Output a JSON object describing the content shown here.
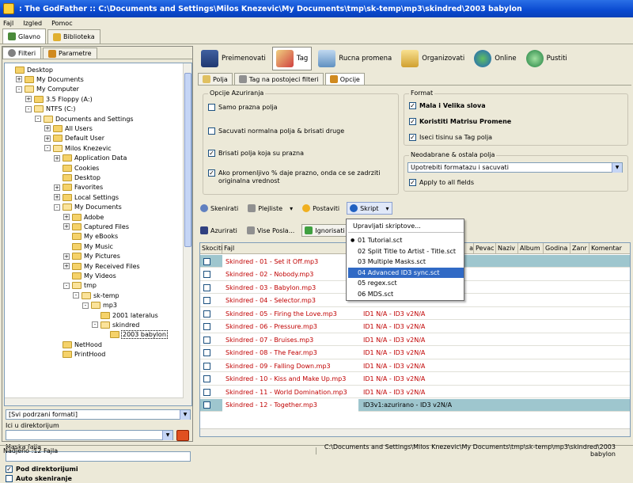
{
  "window": {
    "title": ": The GodFather ::   C:\\Documents and Settings\\Milos Knezevic\\My Documents\\tmp\\sk-temp\\mp3\\skindred\\2003 babylon"
  },
  "menu": [
    "Fajl",
    "Izgled",
    "Pomoc"
  ],
  "top_tabs": [
    {
      "label": "Glavno"
    },
    {
      "label": "Biblioteka"
    }
  ],
  "left_tabs": [
    {
      "label": "Filteri"
    },
    {
      "label": "Parametre"
    }
  ],
  "tree": [
    {
      "label": "Desktop",
      "indent": 0,
      "exp": ""
    },
    {
      "label": "My Documents",
      "indent": 1,
      "exp": "+"
    },
    {
      "label": "My Computer",
      "indent": 1,
      "exp": "-"
    },
    {
      "label": "3.5 Floppy (A:)",
      "indent": 2,
      "exp": "+"
    },
    {
      "label": "NTFS (C:)",
      "indent": 2,
      "exp": "-"
    },
    {
      "label": "Documents and Settings",
      "indent": 3,
      "exp": "-"
    },
    {
      "label": "All Users",
      "indent": 4,
      "exp": "+"
    },
    {
      "label": "Default User",
      "indent": 4,
      "exp": "+"
    },
    {
      "label": "Milos Knezevic",
      "indent": 4,
      "exp": "-"
    },
    {
      "label": "Application Data",
      "indent": 5,
      "exp": "+"
    },
    {
      "label": "Cookies",
      "indent": 5,
      "exp": ""
    },
    {
      "label": "Desktop",
      "indent": 5,
      "exp": ""
    },
    {
      "label": "Favorites",
      "indent": 5,
      "exp": "+"
    },
    {
      "label": "Local Settings",
      "indent": 5,
      "exp": "+"
    },
    {
      "label": "My Documents",
      "indent": 5,
      "exp": "-"
    },
    {
      "label": "Adobe",
      "indent": 6,
      "exp": "+"
    },
    {
      "label": "Captured Files",
      "indent": 6,
      "exp": "+"
    },
    {
      "label": "My eBooks",
      "indent": 6,
      "exp": ""
    },
    {
      "label": "My Music",
      "indent": 6,
      "exp": ""
    },
    {
      "label": "My Pictures",
      "indent": 6,
      "exp": "+"
    },
    {
      "label": "My Received Files",
      "indent": 6,
      "exp": "+"
    },
    {
      "label": "My Videos",
      "indent": 6,
      "exp": ""
    },
    {
      "label": "tmp",
      "indent": 6,
      "exp": "-"
    },
    {
      "label": "sk-temp",
      "indent": 7,
      "exp": "-"
    },
    {
      "label": "mp3",
      "indent": 8,
      "exp": "-"
    },
    {
      "label": "2001 lateralus",
      "indent": 9,
      "exp": ""
    },
    {
      "label": "skindred",
      "indent": 9,
      "exp": "-"
    },
    {
      "label": "2003 babylon",
      "indent": 10,
      "exp": ""
    },
    {
      "label": "NetHood",
      "indent": 5,
      "exp": ""
    },
    {
      "label": "PrintHood",
      "indent": 5,
      "exp": ""
    }
  ],
  "left_bottom": {
    "format_select": "[Svi podrzani formati]",
    "dir_label": "Ici u direktorijum",
    "dir_value": "",
    "mask_label": "Maska fajla",
    "mask_value": "",
    "subdirs_label": "Pod direktorijumi",
    "autoscan_label": "Auto skeniranje"
  },
  "big_toolbar": [
    {
      "label": "Preimenovati"
    },
    {
      "label": "Tag"
    },
    {
      "label": "Rucna promena"
    },
    {
      "label": "Organizovati"
    },
    {
      "label": "Online"
    },
    {
      "label": "Pustiti"
    }
  ],
  "sub_tabs": [
    {
      "label": "Polja"
    },
    {
      "label": "Tag na postojeci filteri"
    },
    {
      "label": "Opcije"
    }
  ],
  "options_group": {
    "title": "Opcije Azuriranja",
    "items": [
      {
        "label": "Samo prazna polja",
        "checked": false
      },
      {
        "label": "Sacuvati normalna polja & brisati druge",
        "checked": false
      },
      {
        "label": "Brisati polja koja su prazna",
        "checked": true
      },
      {
        "label": "Ako promenljivo % daje prazno, onda ce se zadrziti originalna vrednost",
        "checked": true
      }
    ]
  },
  "format_group": {
    "title": "Format",
    "items": [
      {
        "label": "Mala i Velika slova",
        "checked": true
      },
      {
        "label": "Koristiti Matrisu Promene",
        "checked": true
      },
      {
        "label": "Iseci tisinu sa Tag polja",
        "checked": true
      }
    ]
  },
  "unselected_group": {
    "title": "Neodabrane & ostala polja",
    "select_value": "Upotrebiti formatazu i sacuvati",
    "apply_all": "Apply to all fields"
  },
  "toolbar2": [
    {
      "label": "Skenirati"
    },
    {
      "label": "Plejliste"
    },
    {
      "label": "Postaviti"
    },
    {
      "label": "Skript"
    }
  ],
  "toolbar3": [
    {
      "label": "Azurirati"
    },
    {
      "label": "Vise Posla..."
    },
    {
      "label": "Ignorisati"
    }
  ],
  "popup": {
    "header": "Upravljati skriptove...",
    "items": [
      "01 Tutorial.sct",
      "02 Split Title to Artist - Title.sct",
      "03 Multiple Masks.sct",
      "04 Advanced ID3 sync.sct",
      "05 regex.sct",
      "06 MDS.sct"
    ],
    "selected_index": 3,
    "bullet_index": 0
  },
  "table": {
    "columns": [
      "Skociti",
      "Fajl",
      "a",
      "Pevac",
      "Naziv",
      "Album",
      "Godina",
      "Zanr",
      "Komentar"
    ],
    "rows": [
      {
        "file": "Skindred - 01 - Set it Off.mp3",
        "tag": "",
        "hl": true
      },
      {
        "file": "Skindred - 02 - Nobody.mp3",
        "tag": "",
        "hl": false
      },
      {
        "file": "Skindred - 03 - Babylon.mp3",
        "tag": "",
        "hl": false
      },
      {
        "file": "Skindred - 04 - Selector.mp3",
        "tag": "",
        "hl": false
      },
      {
        "file": "Skindred - 05 - Firing the Love.mp3",
        "tag": "ID1 N/A - ID3 v2N/A",
        "hl": false
      },
      {
        "file": "Skindred - 06 - Pressure.mp3",
        "tag": "ID1 N/A - ID3 v2N/A",
        "hl": false
      },
      {
        "file": "Skindred - 07 - Bruises.mp3",
        "tag": "ID1 N/A - ID3 v2N/A",
        "hl": false
      },
      {
        "file": "Skindred - 08 - The Fear.mp3",
        "tag": "ID1 N/A - ID3 v2N/A",
        "hl": false
      },
      {
        "file": "Skindred - 09 - Falling Down.mp3",
        "tag": "ID1 N/A - ID3 v2N/A",
        "hl": false
      },
      {
        "file": "Skindred - 10 - Kiss and Make Up.mp3",
        "tag": "ID1 N/A - ID3 v2N/A",
        "hl": false
      },
      {
        "file": "Skindred - 11 - World Domination.mp3",
        "tag": "ID1 N/A - ID3 v2N/A",
        "hl": false
      },
      {
        "file": "Skindred - 12 - Together.mp3",
        "tag": "ID3v1:azurirano - ID3 v2N/A",
        "hl": true
      }
    ]
  },
  "status": {
    "left": "Nadjeno :12 Fajla",
    "right": "C:\\Documents and Settings\\Milos Knezevic\\My Documents\\tmp\\sk-temp\\mp3\\skindred\\2003 babylon"
  },
  "colors": {
    "title_bar": "#0a4ad0",
    "file_text": "#c00000",
    "row_highlight": "#9ec6ce",
    "menu_select": "#316ac5"
  }
}
